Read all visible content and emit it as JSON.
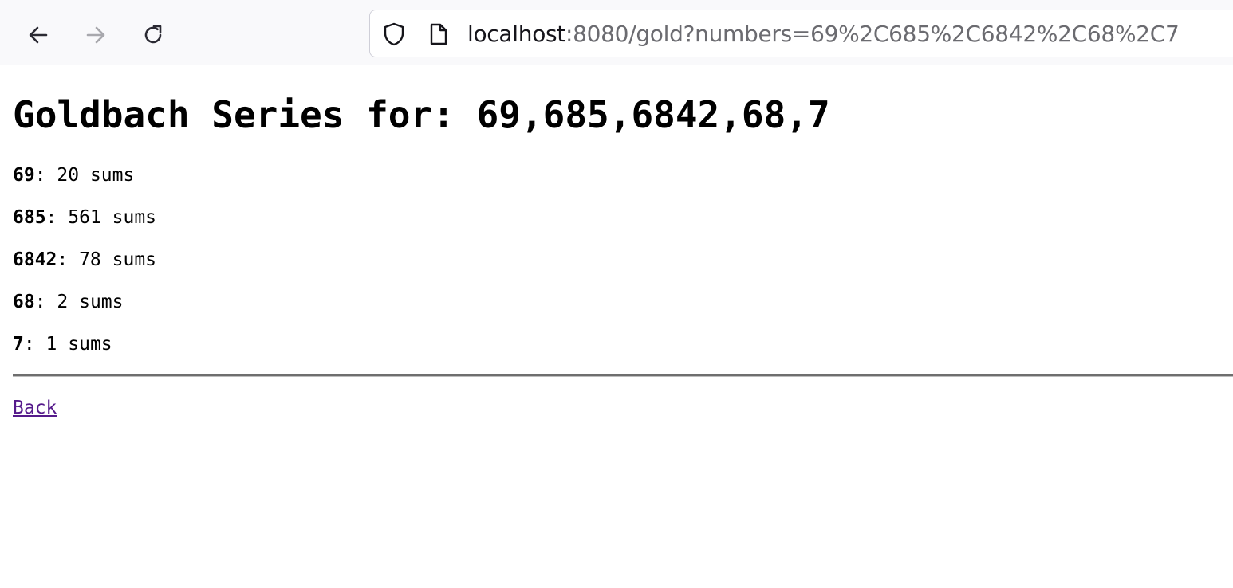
{
  "browser": {
    "url_host": "localhost",
    "url_rest": ":8080/gold?numbers=69%2C685%2C6842%2C68%2C7",
    "icons": {
      "back": "arrow-left-icon",
      "forward": "arrow-right-icon",
      "reload": "reload-icon",
      "security": "shield-icon",
      "page": "page-icon"
    }
  },
  "page": {
    "heading": "Goldbach Series for: 69,685,6842,68,7",
    "results": [
      {
        "number": "69",
        "text": ": 20 sums"
      },
      {
        "number": "685",
        "text": ": 561 sums"
      },
      {
        "number": "6842",
        "text": ": 78 sums"
      },
      {
        "number": "68",
        "text": ": 2 sums"
      },
      {
        "number": "7",
        "text": ": 1 sums"
      }
    ],
    "back_link": "Back"
  },
  "colors": {
    "link_visited": "#551a8b",
    "toolbar_bg": "#f9f9fb"
  }
}
